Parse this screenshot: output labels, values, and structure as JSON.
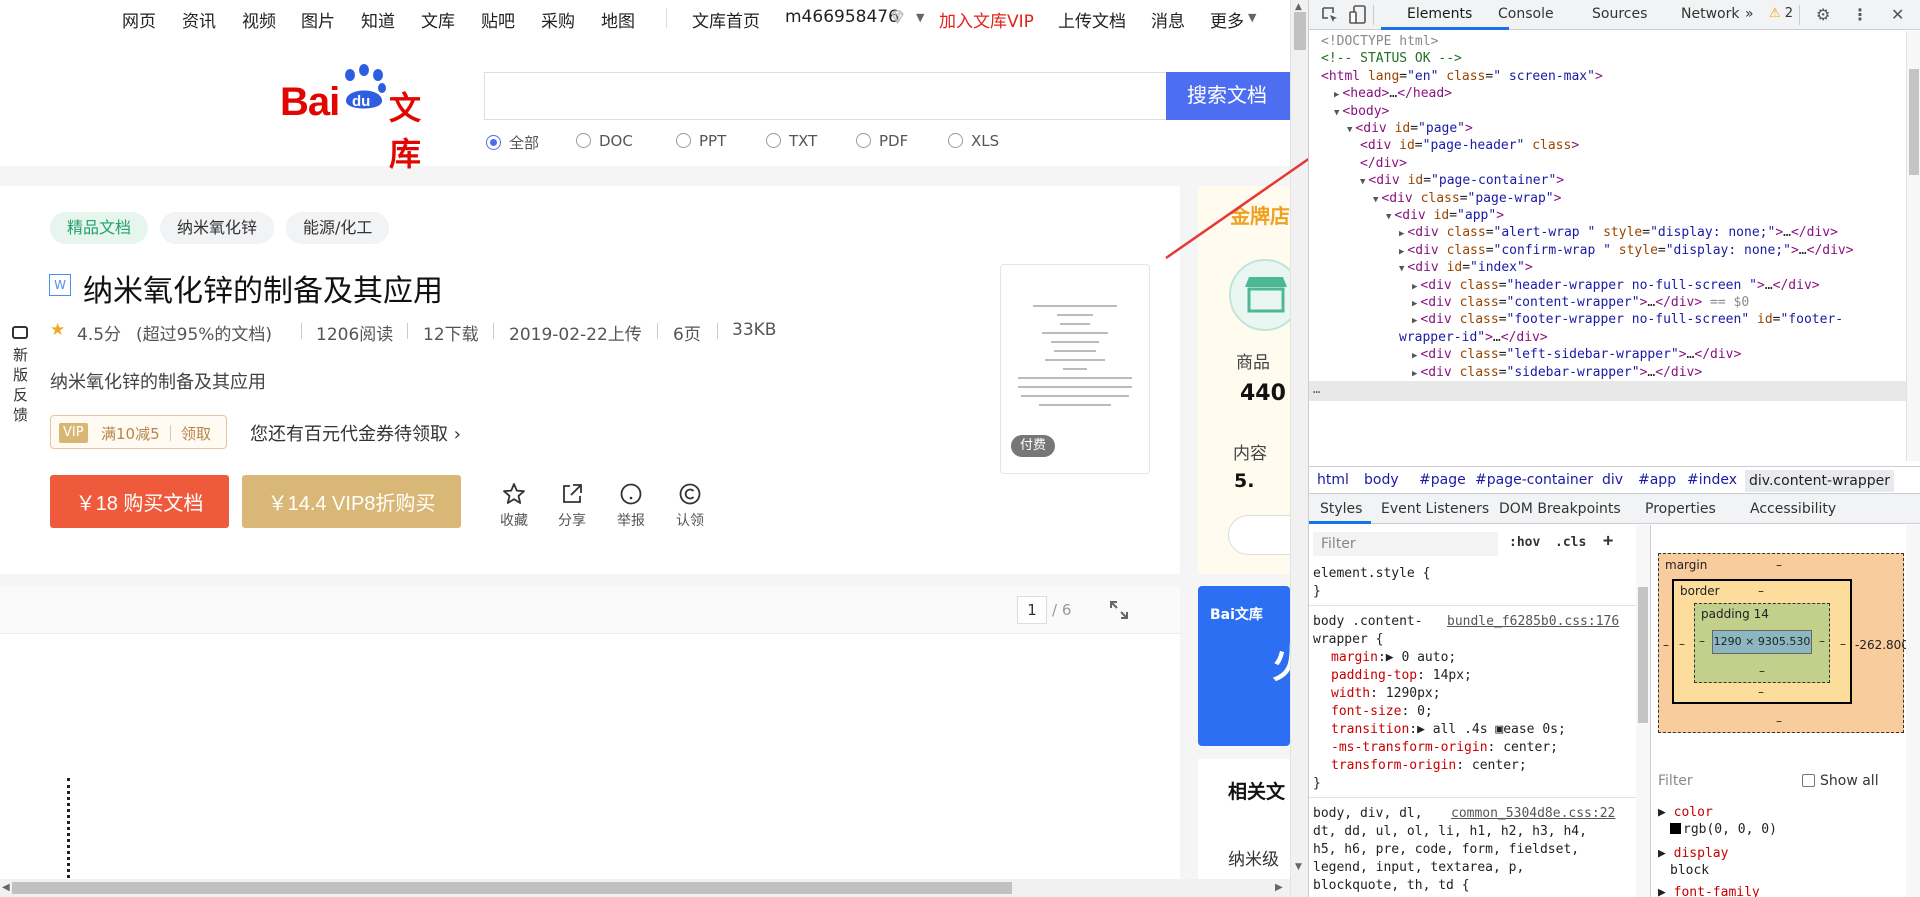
{
  "topnav": {
    "items": [
      "网页",
      "资讯",
      "视频",
      "图片",
      "知道",
      "文库",
      "贴吧",
      "采购",
      "地图"
    ],
    "wenku_home": "文库首页",
    "username": "m466958476",
    "join_vip": "加入文库VIP",
    "upload": "上传文档",
    "messages": "消息",
    "more": "更多"
  },
  "header": {
    "logo_bai": "Bai",
    "logo_du": "du",
    "logo_wenku": "文库",
    "search_placeholder": "",
    "search_button": "搜索文档",
    "filters": [
      "全部",
      "DOC",
      "PPT",
      "TXT",
      "PDF",
      "XLS"
    ],
    "selected_filter": "全部"
  },
  "doc": {
    "tags": [
      "精品文档",
      "纳米氧化锌",
      "能源/化工"
    ],
    "type_badge": "W",
    "title": "纳米氧化锌的制备及其应用",
    "rating": "4.5分",
    "rating_note": "(超过95%的文档)",
    "reads": "1206阅读",
    "downloads": "12下载",
    "upload_date": "2019-02-22上传",
    "pages": "6页",
    "size": "33KB",
    "description": "纳米氧化锌的制备及其应用",
    "coupon_vip": "VIP",
    "coupon_offer": "满10减5",
    "coupon_get": "领取",
    "coupon_text": "您还有百元代金券待领取",
    "buy_button": "￥18 购买文档",
    "vip_button": "￥14.4 VIP8折购买",
    "actions": [
      "收藏",
      "分享",
      "举报",
      "认领"
    ],
    "thumbnail_badge": "付费"
  },
  "reader": {
    "current_page": "1",
    "total_pages": "/ 6"
  },
  "sidebar": {
    "gold_shop": "金牌店",
    "shop_label_1": "商品",
    "shop_number_1": "440",
    "shop_label_2": "内容",
    "shop_number_2": "5.",
    "banner_logo": "Bai文库",
    "banner_char": "火",
    "related_title": "相关文",
    "related_item": "纳米级"
  },
  "feedback": {
    "label": "新版反馈"
  },
  "devtools": {
    "tabs": [
      "Elements",
      "Console",
      "Sources",
      "Network"
    ],
    "active_tab": "Elements",
    "more_tabs": "»",
    "warning_count": "2",
    "dom_lines": [
      {
        "indent": 0,
        "html": "<span class='gr'>&lt;!DOCTYPE html&gt;</span>"
      },
      {
        "indent": 0,
        "html": "<span class='cm'>&lt;!-- STATUS OK --&gt;</span>"
      },
      {
        "indent": 0,
        "html": "<span class='tg'>&lt;html</span> <span class='an'>lang</span>=<span class='av'>\"en\"</span> <span class='an'>class</span>=<span class='av'>\" screen-max\"</span><span class='tg'>&gt;</span>"
      },
      {
        "indent": 1,
        "html": "<span class='tri'>▶</span><span class='tg'>&lt;head&gt;</span>…<span class='tg'>&lt;/head&gt;</span>"
      },
      {
        "indent": 1,
        "html": "<span class='tri'>▼</span><span class='tg'>&lt;body&gt;</span>"
      },
      {
        "indent": 2,
        "html": "<span class='tri'>▼</span><span class='tg'>&lt;div</span> <span class='an'>id</span>=<span class='av'>\"page\"</span><span class='tg'>&gt;</span>"
      },
      {
        "indent": 3,
        "html": "<span class='tg'>&lt;div</span> <span class='an'>id</span>=<span class='av'>\"page-header\"</span> <span class='an'>class</span><span class='tg'>&gt;</span>"
      },
      {
        "indent": 3,
        "html": "<span class='tg'>&lt;/div&gt;</span>"
      },
      {
        "indent": 3,
        "html": "<span class='tri'>▼</span><span class='tg'>&lt;div</span> <span class='an'>id</span>=<span class='av'>\"page-container\"</span><span class='tg'>&gt;</span>"
      },
      {
        "indent": 4,
        "html": "<span class='tri'>▼</span><span class='tg'>&lt;div</span> <span class='an'>class</span>=<span class='av'>\"page-wrap\"</span><span class='tg'>&gt;</span>"
      },
      {
        "indent": 5,
        "html": "<span class='tri'>▼</span><span class='tg'>&lt;div</span> <span class='an'>id</span>=<span class='av'>\"app\"</span><span class='tg'>&gt;</span>"
      },
      {
        "indent": 6,
        "html": "<span class='tri'>▶</span><span class='tg'>&lt;div</span> <span class='an'>class</span>=<span class='av'>\"alert-wrap \"</span> <span class='an'>style</span>=<span class='av'>\"display: none;\"</span><span class='tg'>&gt;</span>…<span class='tg'>&lt;/div&gt;</span>"
      },
      {
        "indent": 6,
        "html": "<span class='tri'>▶</span><span class='tg'>&lt;div</span> <span class='an'>class</span>=<span class='av'>\"confirm-wrap \"</span> <span class='an'>style</span>=<span class='av'>\"display: none;\"</span><span class='tg'>&gt;</span>…<span class='tg'>&lt;/div&gt;</span>"
      },
      {
        "indent": 6,
        "html": "<span class='tri'>▼</span><span class='tg'>&lt;div</span> <span class='an'>id</span>=<span class='av'>\"index\"</span><span class='tg'>&gt;</span>"
      },
      {
        "indent": 7,
        "html": "<span class='tri'>▶</span><span class='tg'>&lt;div</span> <span class='an'>class</span>=<span class='av'>\"header-wrapper no-full-screen \"</span><span class='tg'>&gt;</span>…<span class='tg'>&lt;/div&gt;</span>"
      },
      {
        "indent": 7,
        "html": "<span class='tri'>▶</span><span class='tg'>&lt;div</span> <span class='an'>class</span>=<span class='av'>\"content-wrapper\"</span><span class='tg'>&gt;</span>…<span class='tg'>&lt;/div&gt;</span> <span class='gr'>== $0</span>"
      },
      {
        "indent": 7,
        "html": "<span class='tri'>▶</span><span class='tg'>&lt;div</span> <span class='an'>class</span>=<span class='av'>\"footer-wrapper no-full-screen\"</span> <span class='an'>id</span>=<span class='av'>\"footer-</span>"
      },
      {
        "indent": 6,
        "html": "<span class='av'>wrapper-id\"</span><span class='tg'>&gt;</span>…<span class='tg'>&lt;/div&gt;</span>"
      },
      {
        "indent": 7,
        "html": "<span class='tri'>▶</span><span class='tg'>&lt;div</span> <span class='an'>class</span>=<span class='av'>\"left-sidebar-wrapper\"</span><span class='tg'>&gt;</span>…<span class='tg'>&lt;/div&gt;</span>"
      },
      {
        "indent": 7,
        "html": "<span class='tri'>▶</span><span class='tg'>&lt;div</span> <span class='an'>class</span>=<span class='av'>\"sidebar-wrapper\"</span><span class='tg'>&gt;</span>…<span class='tg'>&lt;/div&gt;</span>"
      }
    ],
    "breadcrumbs": [
      "html",
      "body",
      "#page",
      "#page-container",
      "div",
      "#app",
      "#index",
      "div.content-wrapper"
    ],
    "style_tabs": [
      "Styles",
      "Event Listeners",
      "DOM Breakpoints",
      "Properties",
      "Accessibility"
    ],
    "filter_placeholder": "Filter",
    "hov": ":hov",
    "cls": ".cls",
    "plus": "+",
    "element_style": "element.style {",
    "close_brace": "}",
    "rule_selector_1": "body .content-",
    "rule_selector_2": "wrapper {",
    "rule_source": "bundle_f6285b0.css:176",
    "props": [
      {
        "name": "margin",
        "value": "▶ 0 auto;"
      },
      {
        "name": "padding-top",
        "value": " 14px;"
      },
      {
        "name": "width",
        "value": " 1290px;"
      },
      {
        "name": "font-size",
        "value": " 0;"
      },
      {
        "name": "transition",
        "value": "▶ all .4s ▣ease 0s;"
      },
      {
        "name": "-ms-transform-origin",
        "value": " center;"
      },
      {
        "name": "transform-origin",
        "value": " center;"
      }
    ],
    "rule2_source": "common_5304d8e.css:22",
    "rule2_lines": [
      "body, div, dl,",
      "dt, dd, ul, ol, li, h1, h2, h3, h4,",
      "h5, h6, pre, code, form, fieldset,",
      "legend, input, textarea, p,",
      "blockquote, th, td {"
    ],
    "box": {
      "margin": "margin",
      "border": "border",
      "padding": "padding 14",
      "content": "1290 × 9305.530",
      "dash": "–",
      "right_margin": "-262.800"
    },
    "computed_filter": "Filter",
    "show_all": "Show all",
    "computed": [
      {
        "name": "color",
        "value": "rgb(0, 0, 0)"
      },
      {
        "name": "display",
        "value": "block"
      },
      {
        "name": "font-family",
        "value": ""
      }
    ]
  }
}
